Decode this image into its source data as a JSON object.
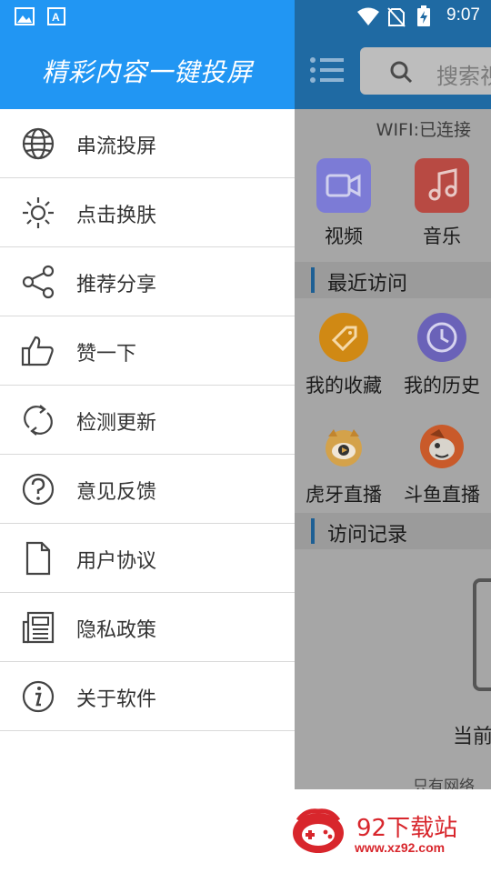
{
  "status_bar": {
    "time": "9:07",
    "icons_left": [
      "image-icon",
      "text-app-icon"
    ],
    "icons_right": [
      "wifi-icon",
      "no-sim-icon",
      "battery-charging-icon"
    ]
  },
  "drawer": {
    "title": "精彩内容一键投屏",
    "accent": "#2196f3",
    "items": [
      {
        "label": "串流投屏",
        "icon": "globe-icon"
      },
      {
        "label": "点击换肤",
        "icon": "sun-icon"
      },
      {
        "label": "推荐分享",
        "icon": "share-icon"
      },
      {
        "label": "赞一下",
        "icon": "thumbs-up-icon"
      },
      {
        "label": "检测更新",
        "icon": "refresh-icon"
      },
      {
        "label": "意见反馈",
        "icon": "question-icon"
      },
      {
        "label": "用户协议",
        "icon": "document-icon"
      },
      {
        "label": "隐私政策",
        "icon": "newspaper-icon"
      },
      {
        "label": "关于软件",
        "icon": "info-icon"
      }
    ]
  },
  "background_app": {
    "search_placeholder": "搜索视",
    "wifi_status": "WIFI:已连接",
    "media_tiles": [
      {
        "label": "视频",
        "icon": "video-icon",
        "color": "#7c7bd6"
      },
      {
        "label": "音乐",
        "icon": "music-icon",
        "color": "#b84a43"
      }
    ],
    "recent_title": "最近访问",
    "recent_tiles": [
      {
        "label": "我的收藏",
        "icon": "tag-icon",
        "color": "#d08914"
      },
      {
        "label": "我的历史",
        "icon": "clock-icon",
        "color": "#6a62b8"
      },
      {
        "label": "虎牙直播",
        "icon": "huya-icon",
        "color": "#d4a24a"
      },
      {
        "label": "斗鱼直播",
        "icon": "douyu-icon",
        "color": "#c95a2a"
      }
    ],
    "history_title": "访问记录",
    "empty_main": "当前",
    "empty_sub": "只有网络"
  },
  "watermark": {
    "name": "92下载站",
    "url": "www.xz92.com"
  }
}
